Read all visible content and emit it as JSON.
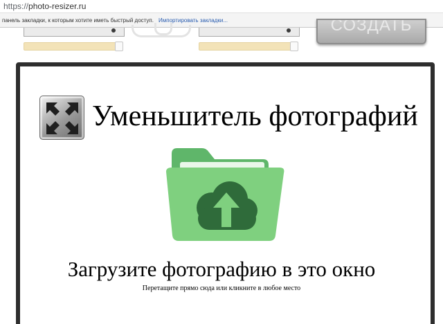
{
  "browser": {
    "url_scheme": "https://",
    "url_host": "photo-resizer.ru",
    "bookmarks_hint": "панель закладки, к которым хотите иметь быстрый доступ.",
    "bookmarks_import_link": "Импортировать закладки..."
  },
  "top_controls": {
    "create_button_label": "СОЗДАТЬ"
  },
  "upload": {
    "app_title": "Уменьшитель фотографий",
    "heading": "Загрузите фотографию в это окно",
    "subtext": "Перетащите прямо сюда или кликните в любое место"
  },
  "icons": {
    "app_logo": "arrows-inward-icon",
    "upload_folder": "folder-cloud-upload-icon"
  },
  "colors": {
    "folder_green": "#7fd07f",
    "border_dark": "#2e2e2e",
    "slider_fill": "#f3e3b8",
    "link_blue": "#2a5db0"
  }
}
